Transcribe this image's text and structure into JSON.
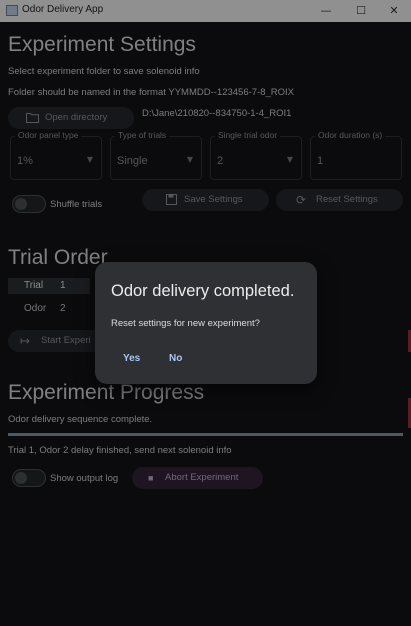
{
  "window": {
    "title": "Odor Delivery App",
    "minimize": "—",
    "maximize": "☐",
    "close": "✕"
  },
  "settings": {
    "heading": "Experiment Settings",
    "folder_instruction": "Select experiment folder to save solenoid info",
    "folder_format": "Folder should be named in the format YYMMDD--123456-7-8_ROIX",
    "open_directory_label": "Open directory",
    "directory_path": "D:\\Jane\\210820--834750-1-4_ROI1",
    "fields": [
      {
        "label": "Odor panel type",
        "value": "1%"
      },
      {
        "label": "Type of trials",
        "value": "Single"
      },
      {
        "label": "Single trial odor",
        "value": "2"
      },
      {
        "label": "Odor duration (s)",
        "value": "1"
      }
    ],
    "shuffle_label": "Shuffle trials",
    "save_label": "Save Settings",
    "reset_label": "Reset Settings"
  },
  "trial_order": {
    "heading": "Trial Order",
    "rows": [
      {
        "label": "Trial",
        "value": "1"
      },
      {
        "label": "Odor",
        "value": "2"
      }
    ],
    "start_label": "Start Experi"
  },
  "progress": {
    "heading": "Experiment Progress",
    "status": "Odor delivery sequence complete.",
    "fraction": 1.0,
    "log_line": "Trial 1, Odor 2 delay finished, send next solenoid info",
    "show_log_label": "Show output log",
    "abort_label": "Abort Experiment"
  },
  "dialog": {
    "title": "Odor delivery completed.",
    "message": "Reset settings for new experiment?",
    "yes_label": "Yes",
    "no_label": "No"
  },
  "colors": {
    "accent_text": "#a9c7f2",
    "progress": "#7a8ea6",
    "abort_bg": "#2f2434",
    "edge_accent": "#9a2b38"
  }
}
